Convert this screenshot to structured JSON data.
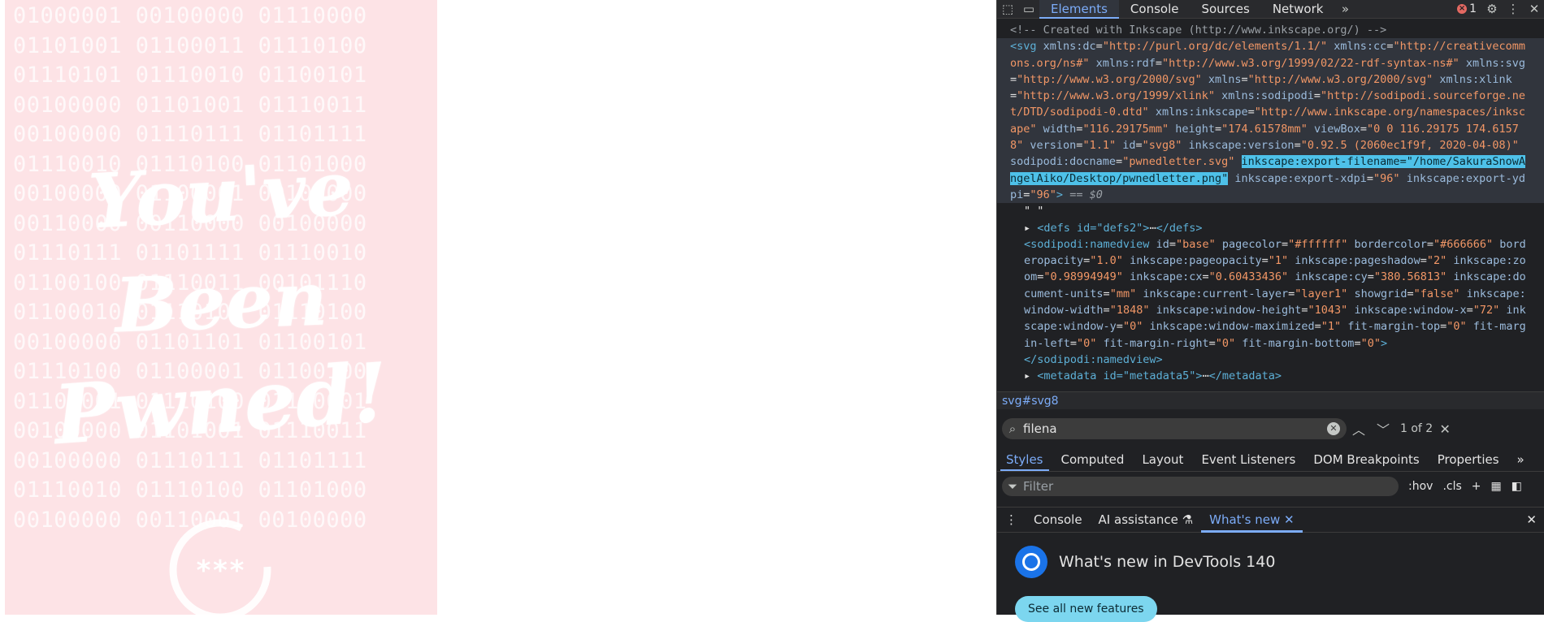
{
  "poster": {
    "binary_lines": [
      "01000001 00100000 01110000",
      "01101001 01100011 01110100",
      "01110101 01110010 01100101",
      "00100000 01101001 01110011",
      "00100000 01110111 01101111",
      "01110010 01110100 01101000",
      "00100000 01100001 00100000",
      "00110000 00110000 00100000",
      "01110111 01101111 01110010",
      "01100100 01110011 00101110",
      "01100010 01110101 01110100",
      "00100000 01101101 01100101",
      "01110100 01100001 01100100",
      "01100001 01110100 01100001",
      "00100000 01101001 01110011",
      "00100000 01110111 01101111",
      "01110010 01110100 01101000",
      "00100000 00110001 00100000"
    ],
    "line1": "You've",
    "line2": "Been",
    "line3": "Pwned!",
    "emblem_text": "***"
  },
  "devtools": {
    "tabs": [
      "Elements",
      "Console",
      "Sources",
      "Network"
    ],
    "active_tab": "Elements",
    "error_count": "1",
    "code": {
      "comment": "<!-- Created with Inkscape (http://www.inkscape.org/) -->",
      "svg_open": "<svg",
      "attrs1": [
        {
          "n": "xmlns:dc",
          "v": "\"http://purl.org/dc/elements/1.1/\""
        },
        {
          "n": "xmlns:cc",
          "v": "\"http://creativecommons.org/ns#\""
        },
        {
          "n": "xmlns:rdf",
          "v": "\"http://www.w3.org/1999/02/22-rdf-syntax-ns#\""
        },
        {
          "n": "xmlns:svg",
          "v": "\"http://www.w3.org/2000/svg\""
        },
        {
          "n": "xmlns",
          "v": "\"http://www.w3.org/2000/svg\""
        },
        {
          "n": "xmlns:xlink",
          "v": "\"http://www.w3.org/1999/xlink\""
        },
        {
          "n": "xmlns:sodipodi",
          "v": "\"http://sodipodi.sourceforge.net/DTD/sodipodi-0.dtd\""
        },
        {
          "n": "xmlns:inkscape",
          "v": "\"http://www.inkscape.org/namespaces/inkscape\""
        },
        {
          "n": "width",
          "v": "\"116.29175mm\""
        },
        {
          "n": "height",
          "v": "\"174.61578mm\""
        },
        {
          "n": "viewBox",
          "v": "\"0 0 116.29175 174.61578\""
        },
        {
          "n": "version",
          "v": "\"1.1\""
        },
        {
          "n": "id",
          "v": "\"svg8\""
        },
        {
          "n": "inkscape:version",
          "v": "\"0.92.5 (2060ec1f9f, 2020-04-08)\""
        },
        {
          "n": "sodipodi:docname",
          "v": "\"pwnedletter.svg\""
        }
      ],
      "highlight": "inkscape:export-filename=\"/home/SakuraSnowAngelAiko/Desktop/pwnedletter.png\"",
      "attrs2": [
        {
          "n": "inkscape:export-xdpi",
          "v": "\"96\""
        },
        {
          "n": "inkscape:export-ydpi",
          "v": "\"96\""
        }
      ],
      "svg_close": ">",
      "eq_dollar": "== $0",
      "text_node": "\" \"",
      "defs": "<defs id=\"defs2\">",
      "defs_close": "</defs>",
      "namedview_open": "<sodipodi:namedview",
      "namedview_attrs": [
        {
          "n": "id",
          "v": "\"base\""
        },
        {
          "n": "pagecolor",
          "v": "\"#ffffff\""
        },
        {
          "n": "bordercolor",
          "v": "\"#666666\""
        },
        {
          "n": "borderopacity",
          "v": "\"1.0\""
        },
        {
          "n": "inkscape:pageopacity",
          "v": "\"1\""
        },
        {
          "n": "inkscape:pageshadow",
          "v": "\"2\""
        },
        {
          "n": "inkscape:zoom",
          "v": "\"0.98994949\""
        },
        {
          "n": "inkscape:cx",
          "v": "\"0.60433436\""
        },
        {
          "n": "inkscape:cy",
          "v": "\"380.56813\""
        },
        {
          "n": "inkscape:document-units",
          "v": "\"mm\""
        },
        {
          "n": "inkscape:current-layer",
          "v": "\"layer1\""
        },
        {
          "n": "showgrid",
          "v": "\"false\""
        },
        {
          "n": "inkscape:window-width",
          "v": "\"1848\""
        },
        {
          "n": "inkscape:window-height",
          "v": "\"1043\""
        },
        {
          "n": "inkscape:window-x",
          "v": "\"72\""
        },
        {
          "n": "inkscape:window-y",
          "v": "\"0\""
        },
        {
          "n": "inkscape:window-maximized",
          "v": "\"1\""
        },
        {
          "n": "fit-margin-top",
          "v": "\"0\""
        },
        {
          "n": "fit-margin-left",
          "v": "\"0\""
        },
        {
          "n": "fit-margin-right",
          "v": "\"0\""
        },
        {
          "n": "fit-margin-bottom",
          "v": "\"0\""
        }
      ],
      "namedview_close": "</sodipodi:namedview>",
      "metadata": "<metadata id=\"metadata5\">",
      "metadata_close": "</metadata>"
    },
    "breadcrumb": "svg#svg8",
    "search": {
      "value": "filena",
      "count": "1 of 2"
    },
    "subtabs": [
      "Styles",
      "Computed",
      "Layout",
      "Event Listeners",
      "DOM Breakpoints",
      "Properties"
    ],
    "active_subtab": "Styles",
    "filter_placeholder": "Filter",
    "filter_tools": [
      ":hov",
      ".cls"
    ],
    "drawer_tabs": [
      "Console",
      "AI assistance",
      "What's new"
    ],
    "whats_new_title": "What's new in DevTools 140",
    "see_all_label": "See all new features",
    "colors": {
      "accent": "#7cacf8",
      "highlight": "#4ec1e9",
      "poster_bg": "#fde3e6"
    }
  }
}
